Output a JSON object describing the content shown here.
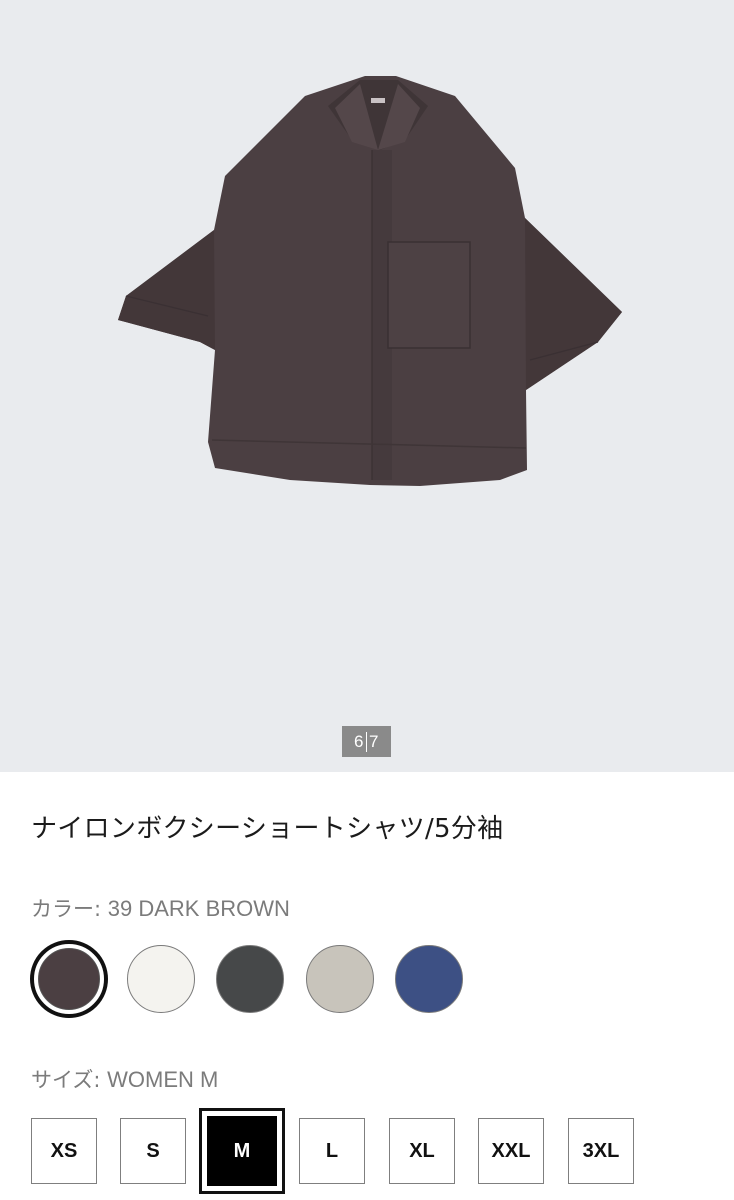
{
  "gallery": {
    "current": "6",
    "total": "7"
  },
  "product": {
    "title": "ナイロンボクシーショートシャツ/5分袖"
  },
  "color": {
    "label": "カラー: ",
    "value": "39 DARK BROWN",
    "options": [
      {
        "name": "dark-brown",
        "hex": "#4b3f42",
        "selected": true
      },
      {
        "name": "off-white",
        "hex": "#f4f3ef",
        "selected": false
      },
      {
        "name": "dark-gray",
        "hex": "#464849",
        "selected": false
      },
      {
        "name": "beige",
        "hex": "#c8c4bb",
        "selected": false
      },
      {
        "name": "blue",
        "hex": "#3d5084",
        "selected": false
      }
    ]
  },
  "size": {
    "label": "サイズ: ",
    "value": "WOMEN M",
    "options": [
      "XS",
      "S",
      "M",
      "L",
      "XL",
      "XXL",
      "3XL"
    ],
    "selected": "M"
  },
  "colors": {
    "hero_bg": "#e9ebee",
    "shirt": "#4b3f42",
    "counter_bg": "#8a8a8a"
  }
}
